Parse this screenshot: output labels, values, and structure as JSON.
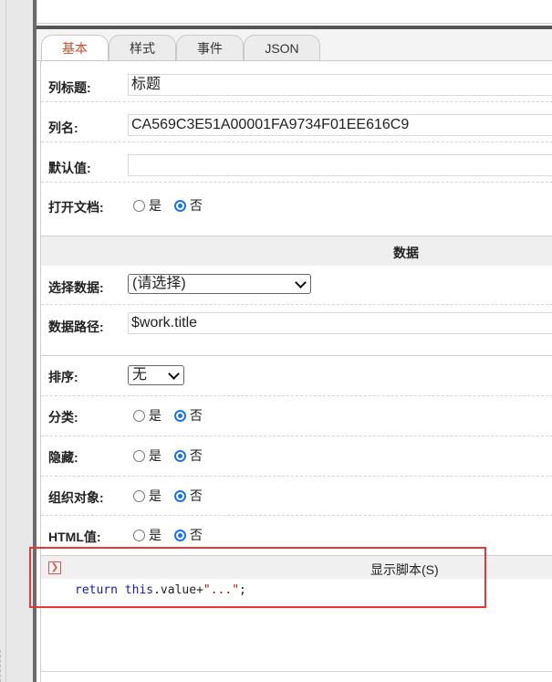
{
  "tabs": [
    {
      "label": "基本",
      "active": true
    },
    {
      "label": "样式",
      "active": false
    },
    {
      "label": "事件",
      "active": false
    },
    {
      "label": "JSON",
      "active": false
    }
  ],
  "fields": {
    "column_title": {
      "label": "列标题:",
      "value": "标题"
    },
    "column_name": {
      "label": "列名:",
      "value": "CA569C3E51A00001FA9734F01EE616C9"
    },
    "default_value": {
      "label": "默认值:",
      "value": ""
    },
    "open_document": {
      "label": "打开文档:",
      "yes": "是",
      "no": "否",
      "selected": "否"
    }
  },
  "data_section": {
    "title": "数据",
    "select_data": {
      "label": "选择数据:",
      "value": "(请选择)"
    },
    "data_path": {
      "label": "数据路径:",
      "value": "$work.title"
    }
  },
  "options": {
    "sort": {
      "label": "排序:",
      "value": "无"
    },
    "category": {
      "label": "分类:",
      "yes": "是",
      "no": "否",
      "selected": "否"
    },
    "hidden": {
      "label": "隐藏:",
      "yes": "是",
      "no": "否",
      "selected": "否"
    },
    "org_object": {
      "label": "组织对象:",
      "yes": "是",
      "no": "否",
      "selected": "否"
    },
    "html_value": {
      "label": "HTML值:",
      "yes": "是",
      "no": "否",
      "selected": "否"
    }
  },
  "script": {
    "title": "显示脚本(S)",
    "code_keyword_return": "return",
    "code_keyword_this": "this",
    "code_middle": ".value+",
    "code_string": "\"...\"",
    "code_end": ";"
  },
  "colors": {
    "active_tab": "#c94a2a",
    "radio_accent": "#1a73e8",
    "highlight_border": "#e53935"
  }
}
